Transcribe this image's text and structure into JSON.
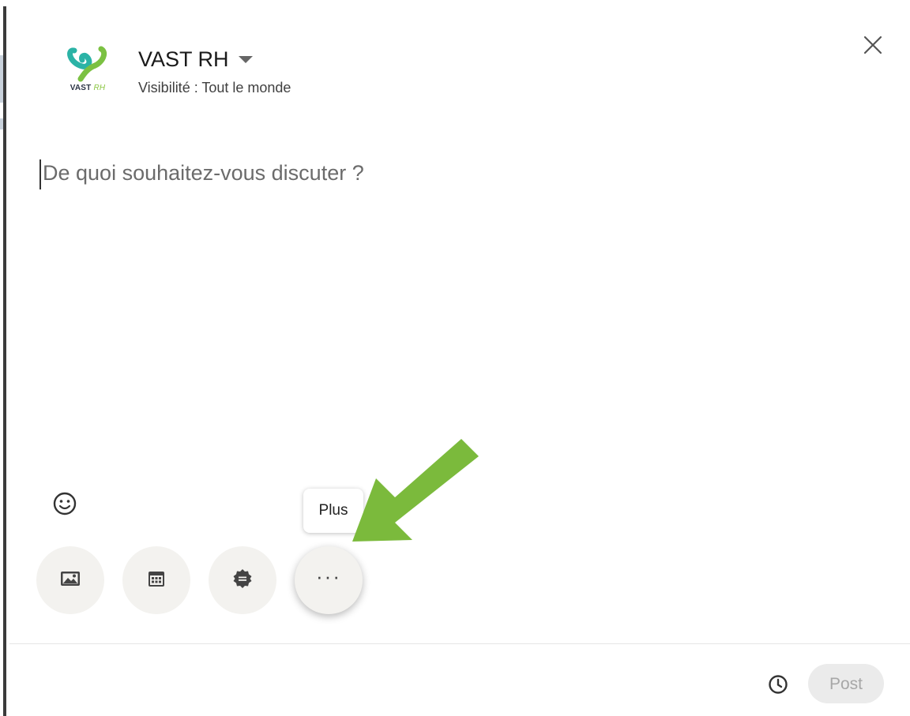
{
  "author": {
    "name": "VAST RH",
    "visibility": "Visibilité : Tout le monde",
    "logo_text": "VAST",
    "logo_script": "RH"
  },
  "editor": {
    "placeholder": "De quoi souhaitez-vous discuter ?"
  },
  "toolbar": {
    "tooltip": "Plus",
    "buttons": [
      {
        "icon": "photo-icon"
      },
      {
        "icon": "calendar-icon"
      },
      {
        "icon": "badge-icon"
      },
      {
        "icon": "more-icon",
        "label": "···"
      }
    ]
  },
  "footer": {
    "post_label": "Post",
    "schedule_icon": "clock-icon"
  },
  "colors": {
    "annotation_arrow": "#7bba3c",
    "post_disabled_bg": "#ebebeb",
    "post_disabled_text": "#a7a7a7",
    "button_bg": "#f3f2ef"
  }
}
